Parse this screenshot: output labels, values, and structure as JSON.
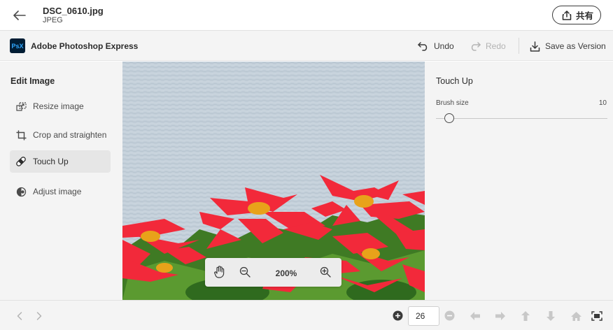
{
  "header": {
    "file_name": "DSC_0610.jpg",
    "file_type": "JPEG",
    "share_label": "共有"
  },
  "appbar": {
    "logo_text": "PsX",
    "app_title": "Adobe Photoshop Express",
    "undo_label": "Undo",
    "redo_label": "Redo",
    "save_label": "Save as Version"
  },
  "left_panel": {
    "heading": "Edit Image",
    "items": [
      {
        "label": "Resize image",
        "icon": "resize-icon"
      },
      {
        "label": "Crop and straighten",
        "icon": "crop-icon"
      },
      {
        "label": "Touch Up",
        "icon": "bandage-icon",
        "active": true
      },
      {
        "label": "Adjust image",
        "icon": "adjust-icon"
      }
    ]
  },
  "canvas": {
    "zoom_level": "200%"
  },
  "right_panel": {
    "title": "Touch Up",
    "brush_label": "Brush size",
    "brush_value": "10"
  },
  "bottombar": {
    "page_value": "26"
  },
  "colors": {
    "water": "#c4d0da",
    "flower_red": "#f2293a",
    "leaf_green": "#4f8a2a",
    "flower_center": "#e8a21a"
  }
}
